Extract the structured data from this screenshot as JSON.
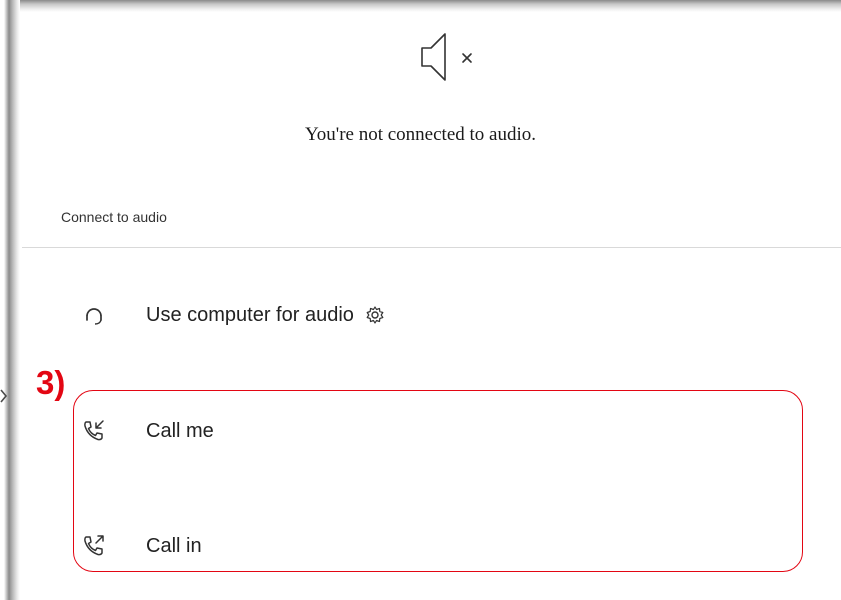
{
  "status": {
    "icon": "speaker-muted-icon",
    "message": "You're not connected to audio."
  },
  "connect_section": {
    "label": "Connect to audio"
  },
  "options": [
    {
      "icon": "headset-icon",
      "label": "Use computer for audio",
      "extra_icon": "gear-icon"
    },
    {
      "icon": "phone-incoming-icon",
      "label": "Call me"
    },
    {
      "icon": "phone-outgoing-icon",
      "label": "Call in"
    }
  ],
  "annotation": {
    "number": "3)",
    "color": "#e30613"
  }
}
